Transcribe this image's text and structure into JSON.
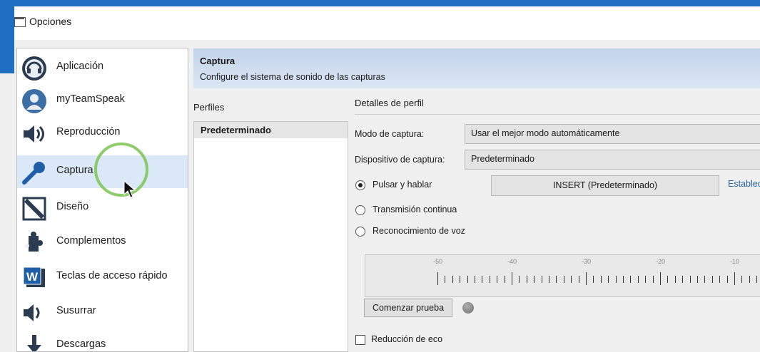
{
  "window": {
    "title": "Opciones"
  },
  "sidebar": {
    "items": [
      {
        "label": "Aplicación",
        "icon": "headset-icon",
        "selected": false
      },
      {
        "label": "myTeamSpeak",
        "icon": "user-profile-icon",
        "selected": false
      },
      {
        "label": "Reproducción",
        "icon": "speaker-icon",
        "selected": false
      },
      {
        "label": "Captura",
        "icon": "microphone-icon",
        "selected": true
      },
      {
        "label": "Diseño",
        "icon": "design-pen-icon",
        "selected": false
      },
      {
        "label": "Complementos",
        "icon": "puzzle-icon",
        "selected": false
      },
      {
        "label": "Teclas de acceso rápido",
        "icon": "keyboard-w-icon",
        "selected": false
      },
      {
        "label": "Susurrar",
        "icon": "whisper-speaker-icon",
        "selected": false
      },
      {
        "label": "Descargas",
        "icon": "download-arrow-icon",
        "selected": false
      }
    ]
  },
  "header": {
    "title": "Captura",
    "subtitle": "Configure el sistema de sonido de las capturas"
  },
  "profiles": {
    "label": "Perfiles",
    "items": [
      "Predeterminado"
    ]
  },
  "details": {
    "label": "Detalles de perfil",
    "capture_mode_label": "Modo de captura:",
    "capture_mode_value": "Usar el mejor modo automáticamente",
    "capture_device_label": "Dispositivo de captura:",
    "capture_device_value": "Predeterminado",
    "push_to_talk_label": "Pulsar y hablar",
    "push_to_talk_selected": true,
    "hotkey_value": "INSERT (Predeterminado)",
    "set_hotkey_link": "Establecer",
    "continuous_label": "Transmisión continua",
    "voice_activation_label": "Reconocimiento de voz",
    "meter_ticks": [
      "-50",
      "-40",
      "-30",
      "-20",
      "-10"
    ],
    "test_button_label": "Comenzar prueba",
    "echo_reduction_label": "Reducción de eco",
    "echo_reduction_checked": false
  },
  "colors": {
    "accent_blue": "#1e6fc2",
    "selection": "#dbe8f7",
    "cursor_highlight": "#7bc451",
    "link": "#1f5fa8"
  }
}
